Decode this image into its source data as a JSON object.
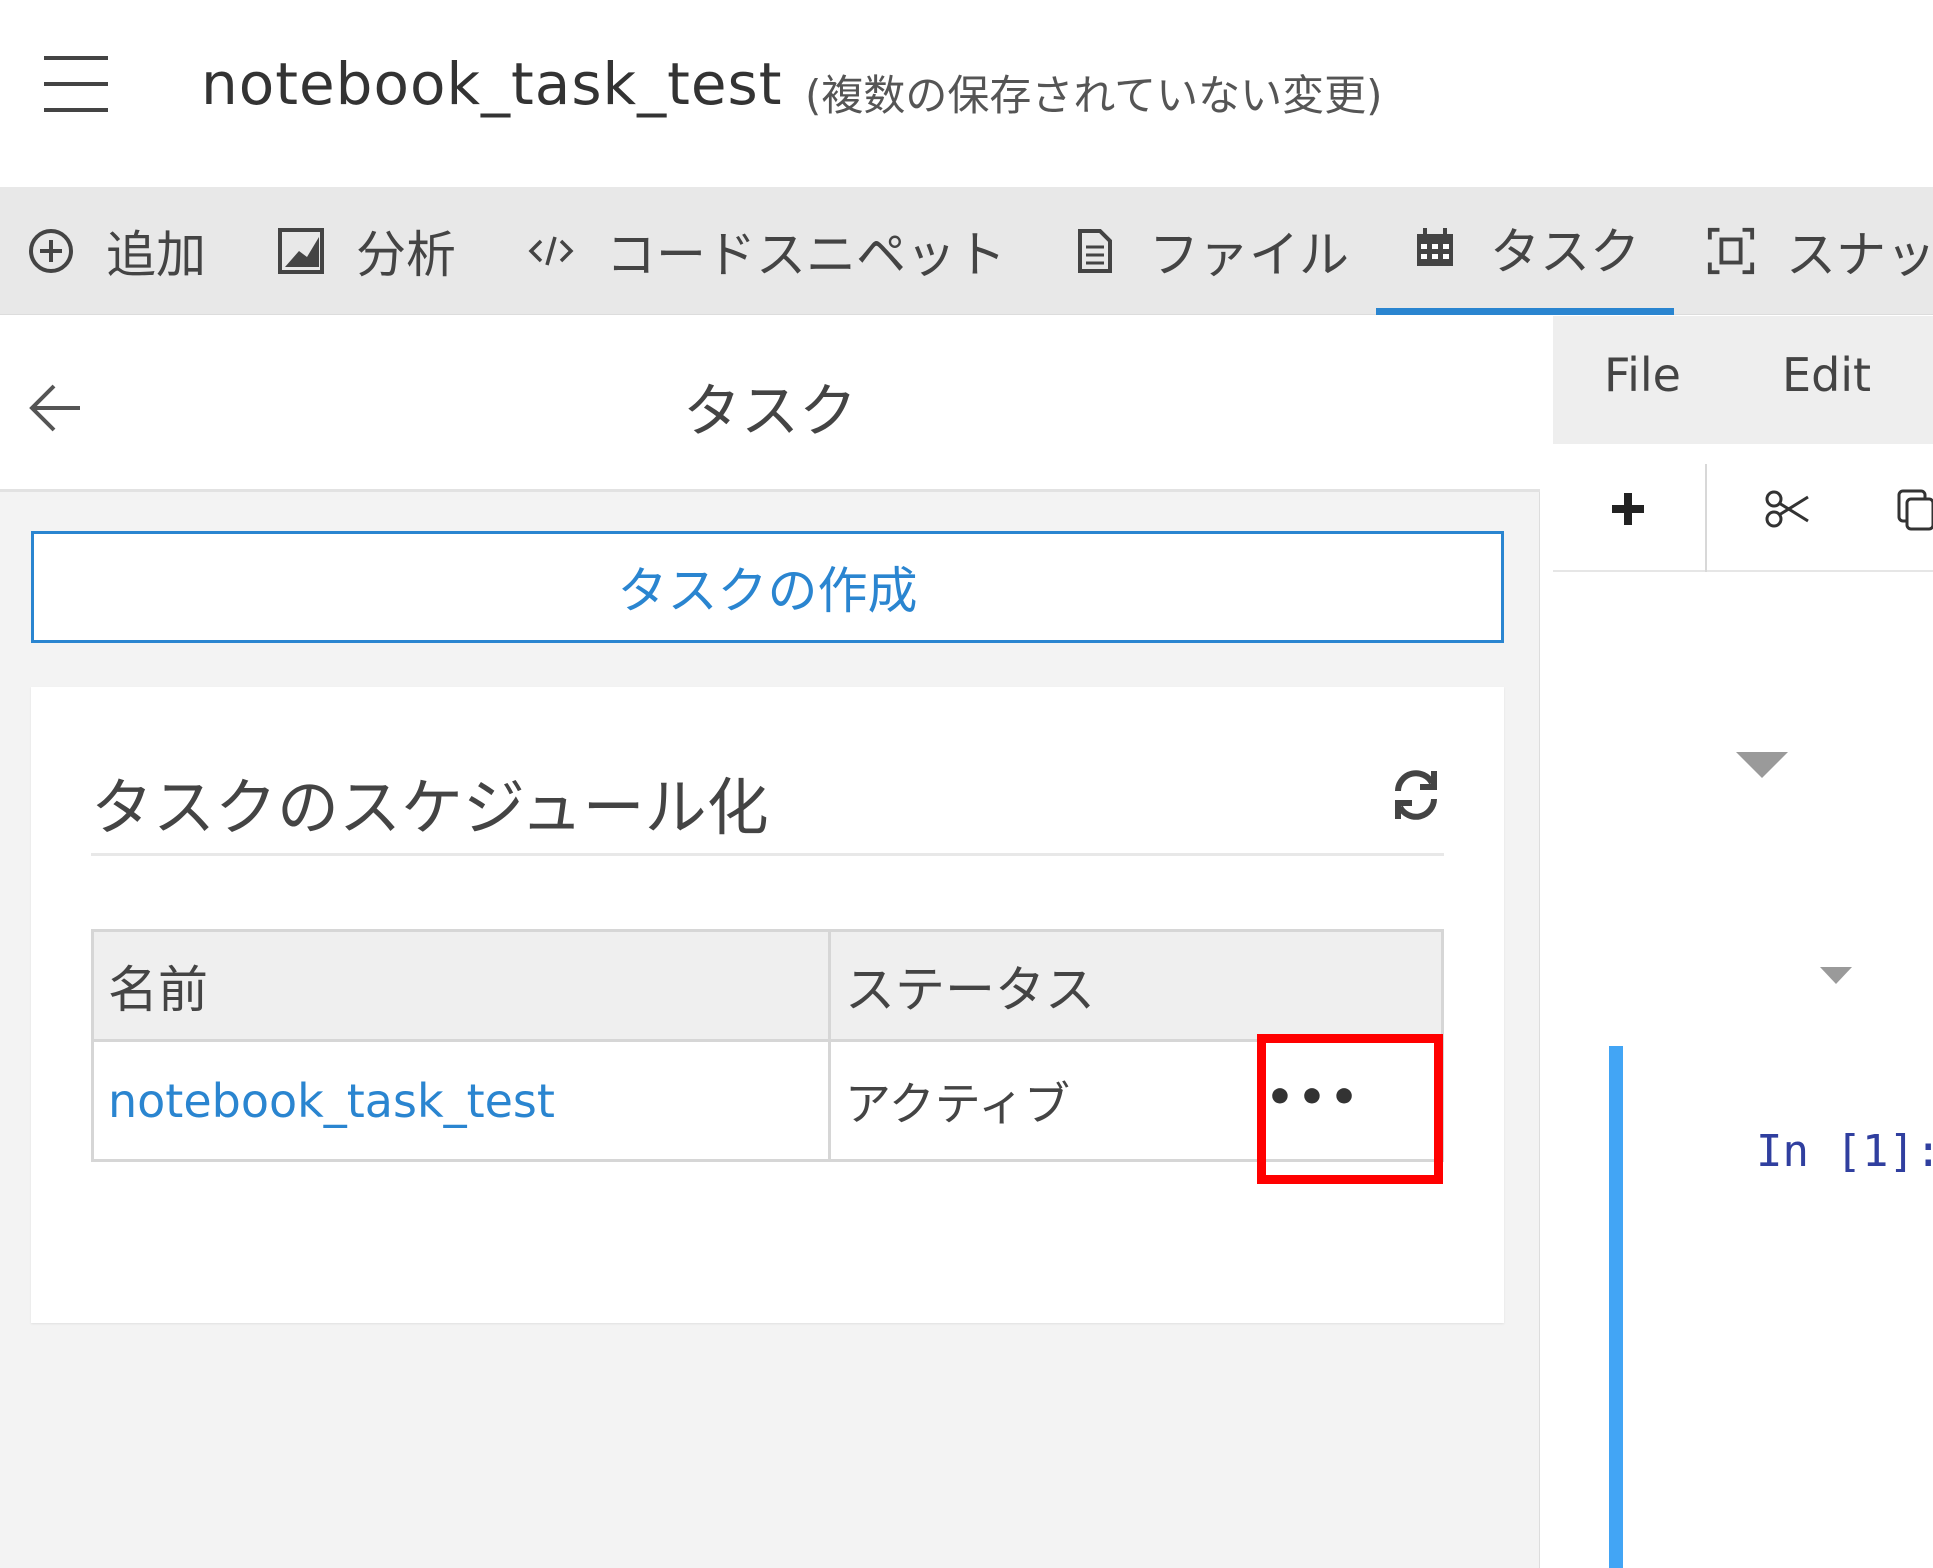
{
  "header": {
    "notebook_title": "notebook_task_test",
    "unsaved_note": "(複数の保存されていない変更)"
  },
  "toolbar": {
    "items": [
      {
        "label": "追加",
        "icon": "plus-circle-icon"
      },
      {
        "label": "分析",
        "icon": "chart-icon"
      },
      {
        "label": "コードスニペット",
        "icon": "code-icon"
      },
      {
        "label": "ファイル",
        "icon": "document-icon"
      },
      {
        "label": "タスク",
        "icon": "calendar-icon",
        "active": true
      },
      {
        "label": "スナッ",
        "icon": "snapshot-icon"
      }
    ]
  },
  "task_panel": {
    "title": "タスク",
    "create_button": "タスクの作成",
    "section_title": "タスクのスケジュール化",
    "table": {
      "headers": [
        "名前",
        "ステータス"
      ],
      "rows": [
        {
          "name": "notebook_task_test",
          "status": "アクティブ",
          "actions": "•••"
        }
      ]
    }
  },
  "notebook": {
    "menu": [
      "File",
      "Edit"
    ],
    "cell_prompt": "In [1]:"
  },
  "colors": {
    "accent": "#2a85d0",
    "highlight": "#ff0000",
    "cell_border": "#42a5f5"
  }
}
